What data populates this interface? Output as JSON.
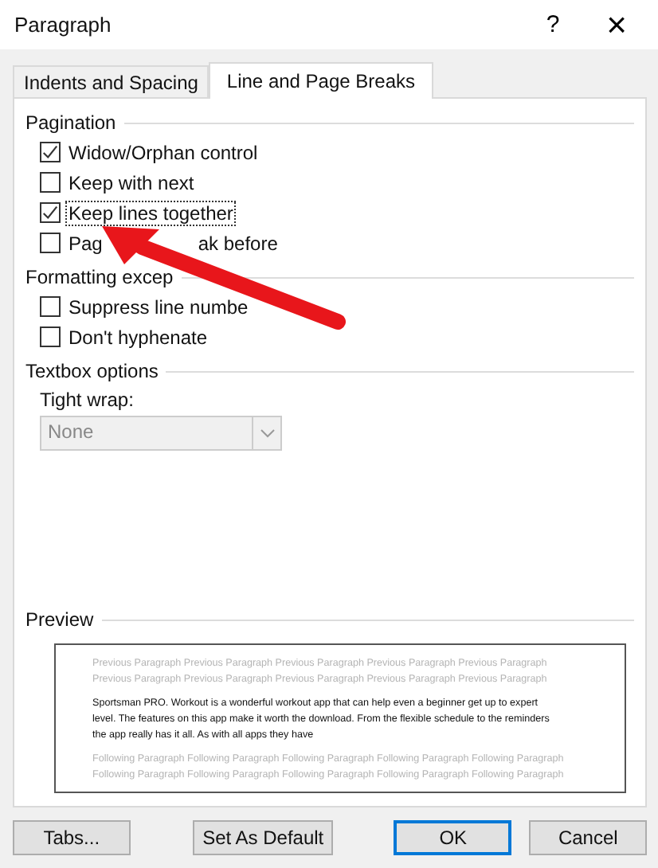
{
  "window": {
    "title": "Paragraph",
    "help": "?",
    "close": "×"
  },
  "tabs": [
    {
      "label": "Indents and Spacing",
      "selected": false
    },
    {
      "label": "Line and Page Breaks",
      "selected": true
    }
  ],
  "sections": [
    {
      "title": "Pagination",
      "options": [
        {
          "label": "Widow/Orphan control",
          "checked": true,
          "focused": false
        },
        {
          "label": "Keep with next",
          "checked": false,
          "focused": false
        },
        {
          "label": "Keep lines together",
          "checked": true,
          "focused": true
        },
        {
          "label": "Pag",
          "rest": "ak before",
          "checked": false,
          "focused": false
        }
      ]
    },
    {
      "title": "Formatting excep",
      "options": [
        {
          "label": "Suppress line numbe",
          "checked": false,
          "focused": false
        },
        {
          "label": "Don't hyphenate",
          "checked": false,
          "focused": false
        }
      ]
    },
    {
      "title": "Textbox options",
      "field": {
        "label": "Tight wrap:",
        "value": "None",
        "disabled": true
      }
    }
  ],
  "preview": {
    "title": "Preview",
    "previous": [
      "Previous Paragraph Previous Paragraph Previous Paragraph Previous Paragraph Previous Paragraph",
      "Previous Paragraph Previous Paragraph Previous Paragraph Previous Paragraph Previous Paragraph"
    ],
    "current": [
      "Sportsman PRO. Workout is a wonderful workout app that can help even a beginner get up to expert",
      "level. The features on this app make it worth the download. From the flexible schedule to the reminders",
      "the app really has it all. As with all apps they have"
    ],
    "following": [
      "Following Paragraph Following Paragraph Following Paragraph Following Paragraph Following Paragraph",
      "Following Paragraph Following Paragraph Following Paragraph Following Paragraph Following Paragraph"
    ]
  },
  "buttons": [
    {
      "label": "Tabs...",
      "default": false
    },
    {
      "label": "Set As Default",
      "default": false
    },
    {
      "label": "OK",
      "default": true
    },
    {
      "label": "Cancel",
      "default": false
    }
  ]
}
